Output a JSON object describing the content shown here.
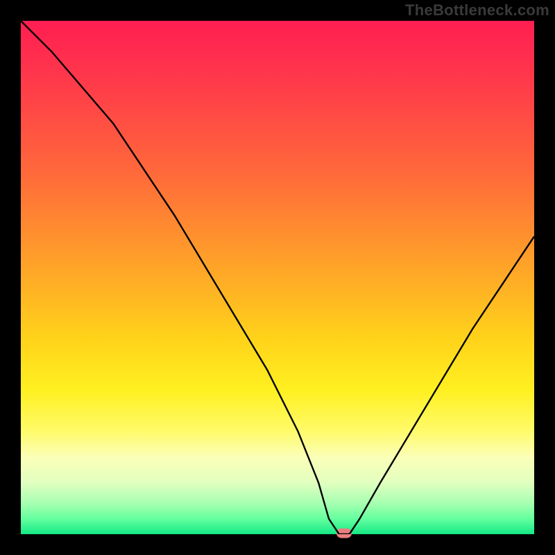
{
  "attribution": "TheBottleneck.com",
  "chart_data": {
    "type": "line",
    "title": "",
    "xlabel": "",
    "ylabel": "",
    "xlim": [
      0,
      100
    ],
    "ylim": [
      0,
      100
    ],
    "grid": false,
    "legend": false,
    "series": [
      {
        "name": "bottleneck-curve",
        "x": [
          0,
          6,
          12,
          18,
          24,
          30,
          36,
          42,
          48,
          54,
          58,
          60,
          62,
          64,
          66,
          70,
          76,
          82,
          88,
          94,
          100
        ],
        "values": [
          100,
          94,
          87,
          80,
          71,
          62,
          52,
          42,
          32,
          20,
          10,
          3,
          0,
          0,
          3,
          10,
          20,
          30,
          40,
          49,
          58
        ]
      }
    ],
    "marker": {
      "x": 63,
      "y": 0
    },
    "background_gradient": {
      "top_color": "#ff1e52",
      "bottom_color": "#14e885"
    }
  }
}
